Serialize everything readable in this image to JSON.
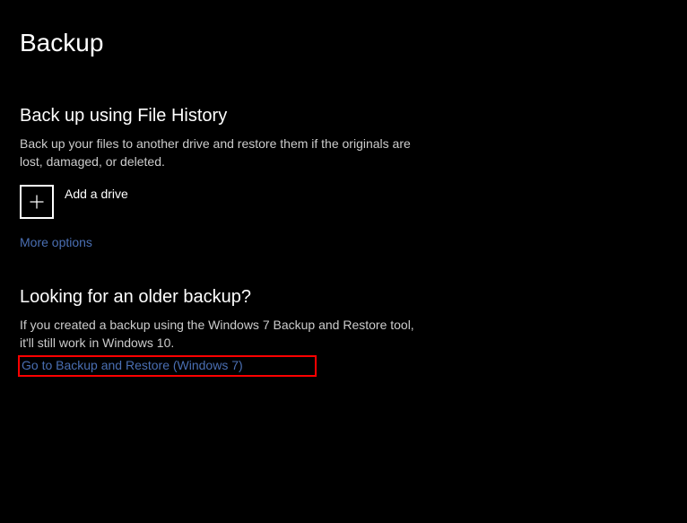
{
  "page": {
    "title": "Backup"
  },
  "fileHistory": {
    "heading": "Back up using File History",
    "description": "Back up your files to another drive and restore them if the originals are lost, damaged, or deleted.",
    "addDriveLabel": "Add a drive",
    "moreOptionsLabel": "More options"
  },
  "olderBackup": {
    "heading": "Looking for an older backup?",
    "description": "If you created a backup using the Windows 7 Backup and Restore tool, it'll still work in Windows 10.",
    "linkLabel": "Go to Backup and Restore (Windows 7)"
  },
  "colors": {
    "link": "#4a6fb3",
    "highlight": "#ff0000"
  }
}
